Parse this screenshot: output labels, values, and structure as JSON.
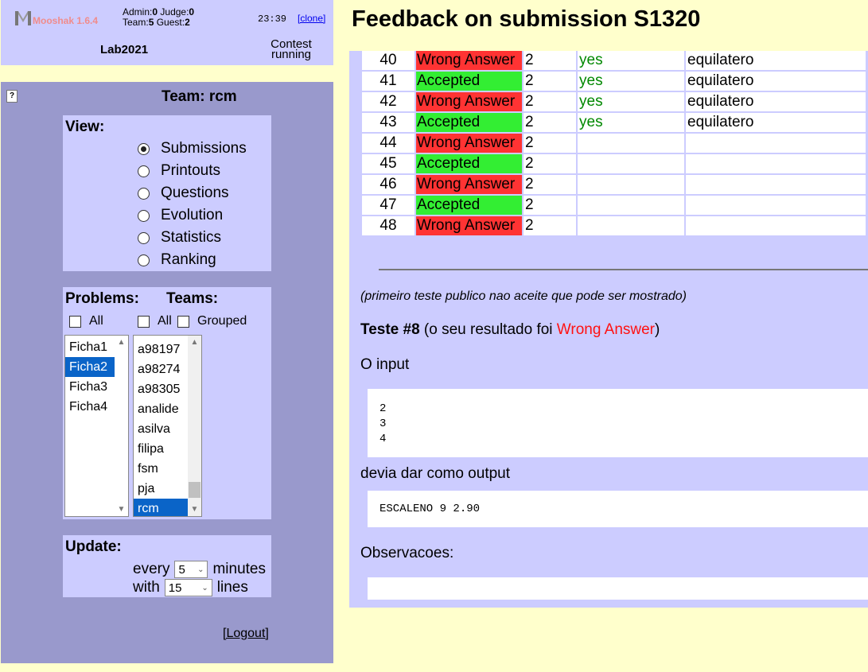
{
  "header": {
    "app_name": "Mooshak 1.6.4",
    "admin_label": "Admin:",
    "admin_count": "0",
    "judge_label": "Judge:",
    "judge_count": "0",
    "team_label": "Team:",
    "team_count": "5",
    "guest_label": "Guest:",
    "guest_count": "2",
    "clock": "23:39",
    "clone_label": "[clone]",
    "contest_name": "Lab2021",
    "contest_status": "Contest running"
  },
  "panel": {
    "team_title": "Team: rcm",
    "help_icon_glyph": "?",
    "view": {
      "title": "View:",
      "options": [
        {
          "label": "Submissions",
          "checked": true
        },
        {
          "label": "Printouts",
          "checked": false
        },
        {
          "label": "Questions",
          "checked": false
        },
        {
          "label": "Evolution",
          "checked": false
        },
        {
          "label": "Statistics",
          "checked": false
        },
        {
          "label": "Ranking",
          "checked": false
        }
      ]
    },
    "problems": {
      "title": "Problems:",
      "all_label": "All",
      "items": [
        "Ficha1",
        "Ficha2",
        "Ficha3",
        "Ficha4"
      ],
      "selected": "Ficha2"
    },
    "teams": {
      "title": "Teams:",
      "all_label": "All",
      "grouped_label": "Grouped",
      "items": [
        "a98197",
        "a98274",
        "a98305",
        "analide",
        "asilva",
        "filipa",
        "fsm",
        "pja",
        "rcm"
      ],
      "selected": "rcm"
    },
    "update": {
      "title": "Update:",
      "every_label": "every",
      "every_value": "5",
      "minutes_label": "minutes",
      "with_label": "with",
      "with_value": "15",
      "lines_label": "lines"
    },
    "logout_label": "[Logout]"
  },
  "main": {
    "title": "Feedback on submission S1320",
    "results": [
      {
        "num": "40",
        "result": "Wrong Answer",
        "value": "2",
        "ok": "yes",
        "name": "equilatero"
      },
      {
        "num": "41",
        "result": "Accepted",
        "value": "2",
        "ok": "yes",
        "name": "equilatero"
      },
      {
        "num": "42",
        "result": "Wrong Answer",
        "value": "2",
        "ok": "yes",
        "name": "equilatero"
      },
      {
        "num": "43",
        "result": "Accepted",
        "value": "2",
        "ok": "yes",
        "name": "equilatero"
      },
      {
        "num": "44",
        "result": "Wrong Answer",
        "value": "2",
        "ok": "",
        "name": ""
      },
      {
        "num": "45",
        "result": "Accepted",
        "value": "2",
        "ok": "",
        "name": ""
      },
      {
        "num": "46",
        "result": "Wrong Answer",
        "value": "2",
        "ok": "",
        "name": ""
      },
      {
        "num": "47",
        "result": "Accepted",
        "value": "2",
        "ok": "",
        "name": ""
      },
      {
        "num": "48",
        "result": "Wrong Answer",
        "value": "2",
        "ok": "",
        "name": ""
      }
    ],
    "note": "(primeiro teste publico nao aceite que pode ser mostrado)",
    "test_label": "Teste #8",
    "test_prefix": " (o seu resultado foi ",
    "test_result": "Wrong Answer",
    "test_suffix": ")",
    "input_label": "O input",
    "input_lines": [
      "2",
      "3",
      "4"
    ],
    "output_label": "devia dar como output",
    "output_text": "ESCALENO 9 2.90",
    "obs_label": "Observacoes:"
  },
  "colors": {
    "accepted": "#33ee33",
    "wrong_answer": "#ff3333",
    "panel_bg": "#9999cc",
    "box_bg": "#ccccff",
    "page_bg": "#ffffcc"
  }
}
